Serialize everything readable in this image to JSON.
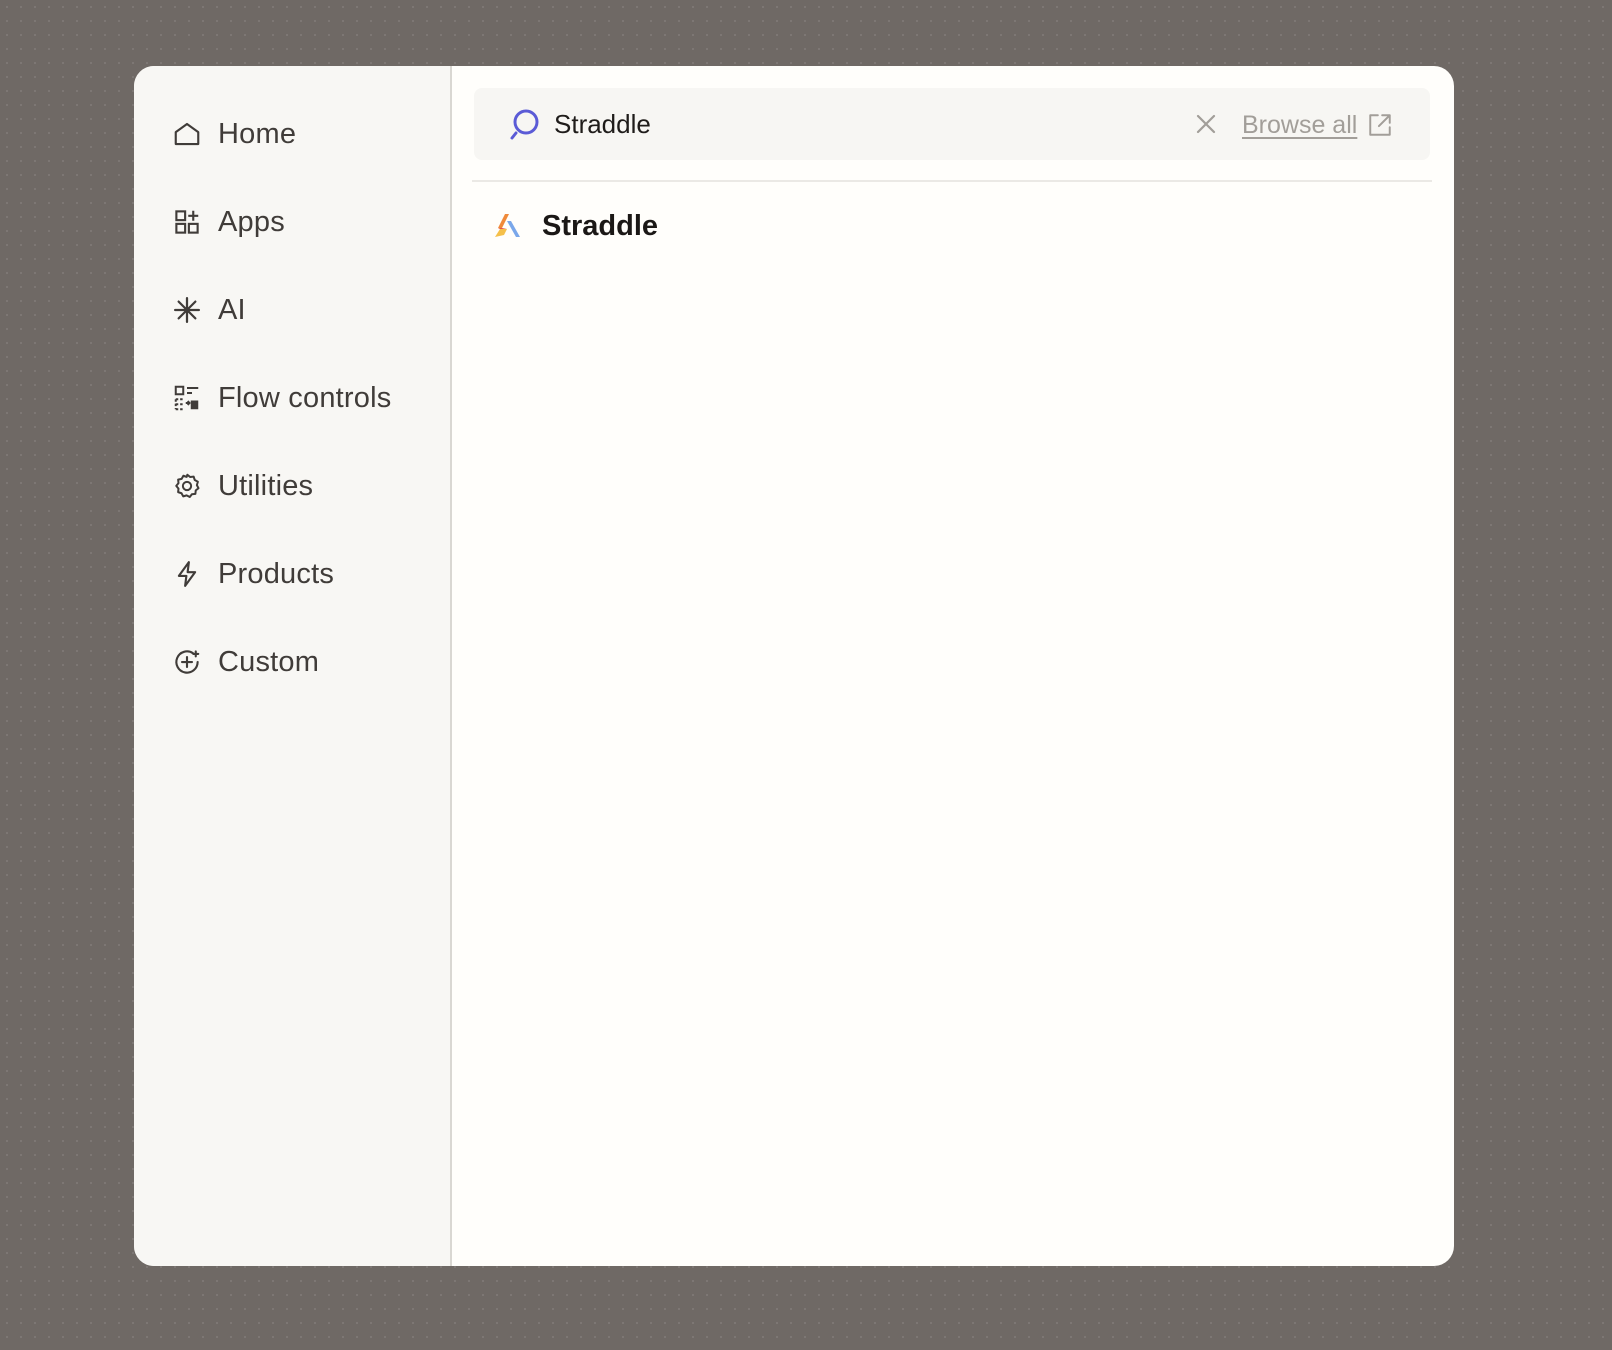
{
  "sidebar": {
    "items": [
      {
        "label": "Home",
        "icon": "home-icon"
      },
      {
        "label": "Apps",
        "icon": "apps-icon"
      },
      {
        "label": "AI",
        "icon": "ai-sparkle-icon"
      },
      {
        "label": "Flow controls",
        "icon": "flow-controls-icon"
      },
      {
        "label": "Utilities",
        "icon": "gear-icon"
      },
      {
        "label": "Products",
        "icon": "bolt-icon"
      },
      {
        "label": "Custom",
        "icon": "custom-plus-icon"
      }
    ]
  },
  "search": {
    "value": "Straddle",
    "browse_all_label": "Browse all"
  },
  "results": [
    {
      "label": "Straddle",
      "icon": "straddle-logo"
    }
  ],
  "colors": {
    "backdrop": "#6f6965",
    "sidebar_bg": "#f8f7f4",
    "panel_bg": "#fffefb",
    "search_accent": "#5b5bd6",
    "muted_text": "#a29e99"
  }
}
